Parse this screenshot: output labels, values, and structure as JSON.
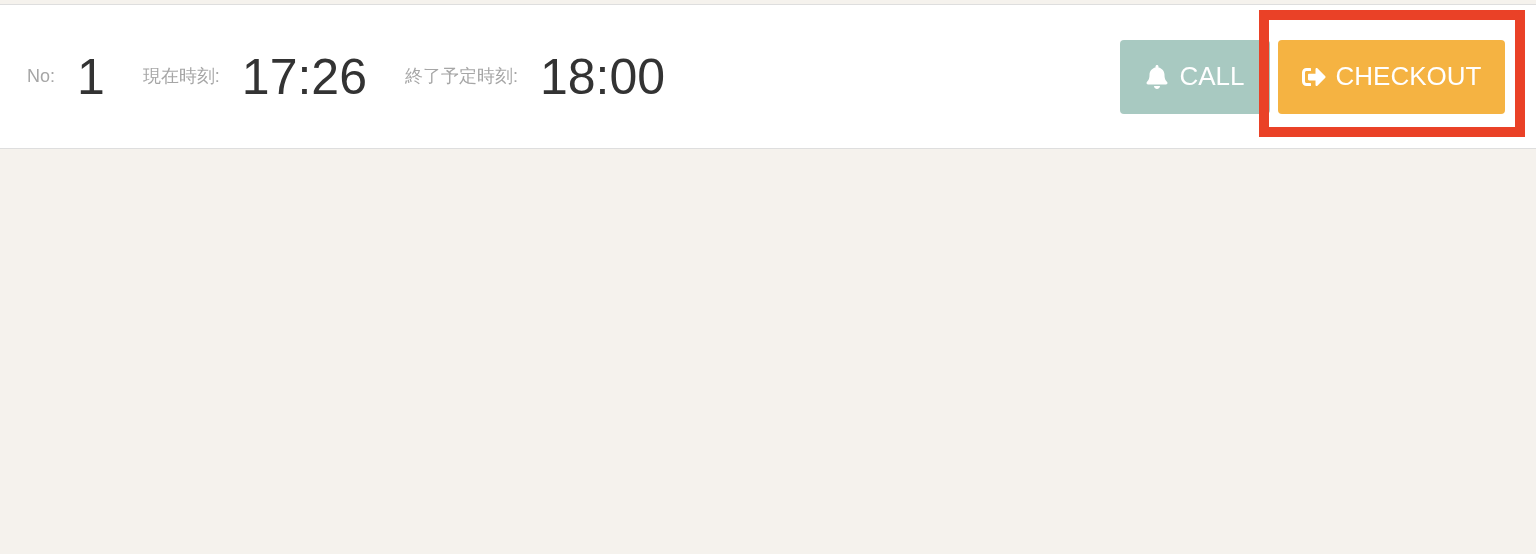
{
  "header": {
    "fields": [
      {
        "label": "No:",
        "value": "1"
      },
      {
        "label": "現在時刻:",
        "value": "17:26"
      },
      {
        "label": "終了予定時刻:",
        "value": "18:00"
      }
    ],
    "buttons": [
      {
        "kind": "call",
        "label": "CALL",
        "highlighted": false
      },
      {
        "kind": "checkout",
        "label": "CHECKOUT",
        "highlighted": true
      }
    ]
  }
}
